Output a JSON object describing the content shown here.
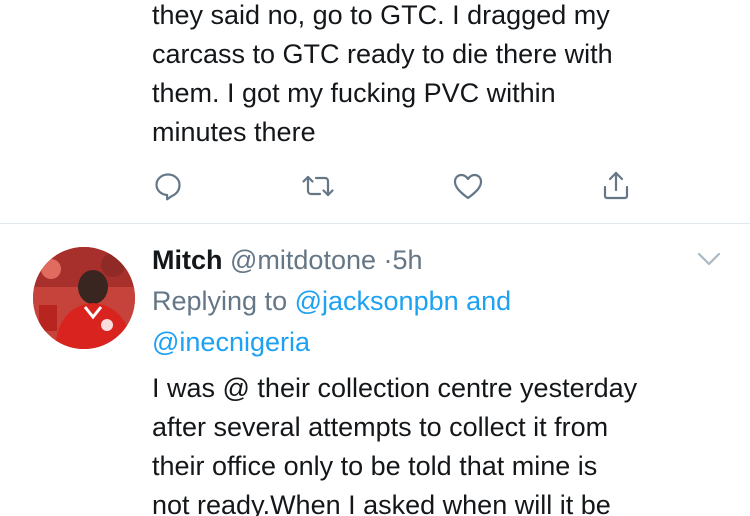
{
  "first_tweet": {
    "text_lines": [
      "they said no, go to GTC. I dragged my",
      "carcass to GTC ready to die there with",
      "them. I got my fucking PVC within",
      "minutes there"
    ],
    "actions": [
      {
        "icon": "reply-icon"
      },
      {
        "icon": "retweet-icon"
      },
      {
        "icon": "like-icon"
      },
      {
        "icon": "share-icon"
      }
    ]
  },
  "reply_tweet": {
    "name": "Mitch",
    "handle": "@mitdotone",
    "separator": "·",
    "time": "5h",
    "replying_prefix": "Replying to",
    "mention_1": "@jacksonpbn",
    "conjunction": "and",
    "mention_2": "@inecnigeria",
    "text_lines": [
      "I was @ their collection centre yesterday",
      "after several attempts to collect it from",
      "their office only to be told that mine is",
      "not ready.When I asked when will it be"
    ]
  },
  "colors": {
    "text": "#14171a",
    "secondary": "#657786",
    "link": "#1da1f2",
    "divider": "#e1e8ed"
  }
}
